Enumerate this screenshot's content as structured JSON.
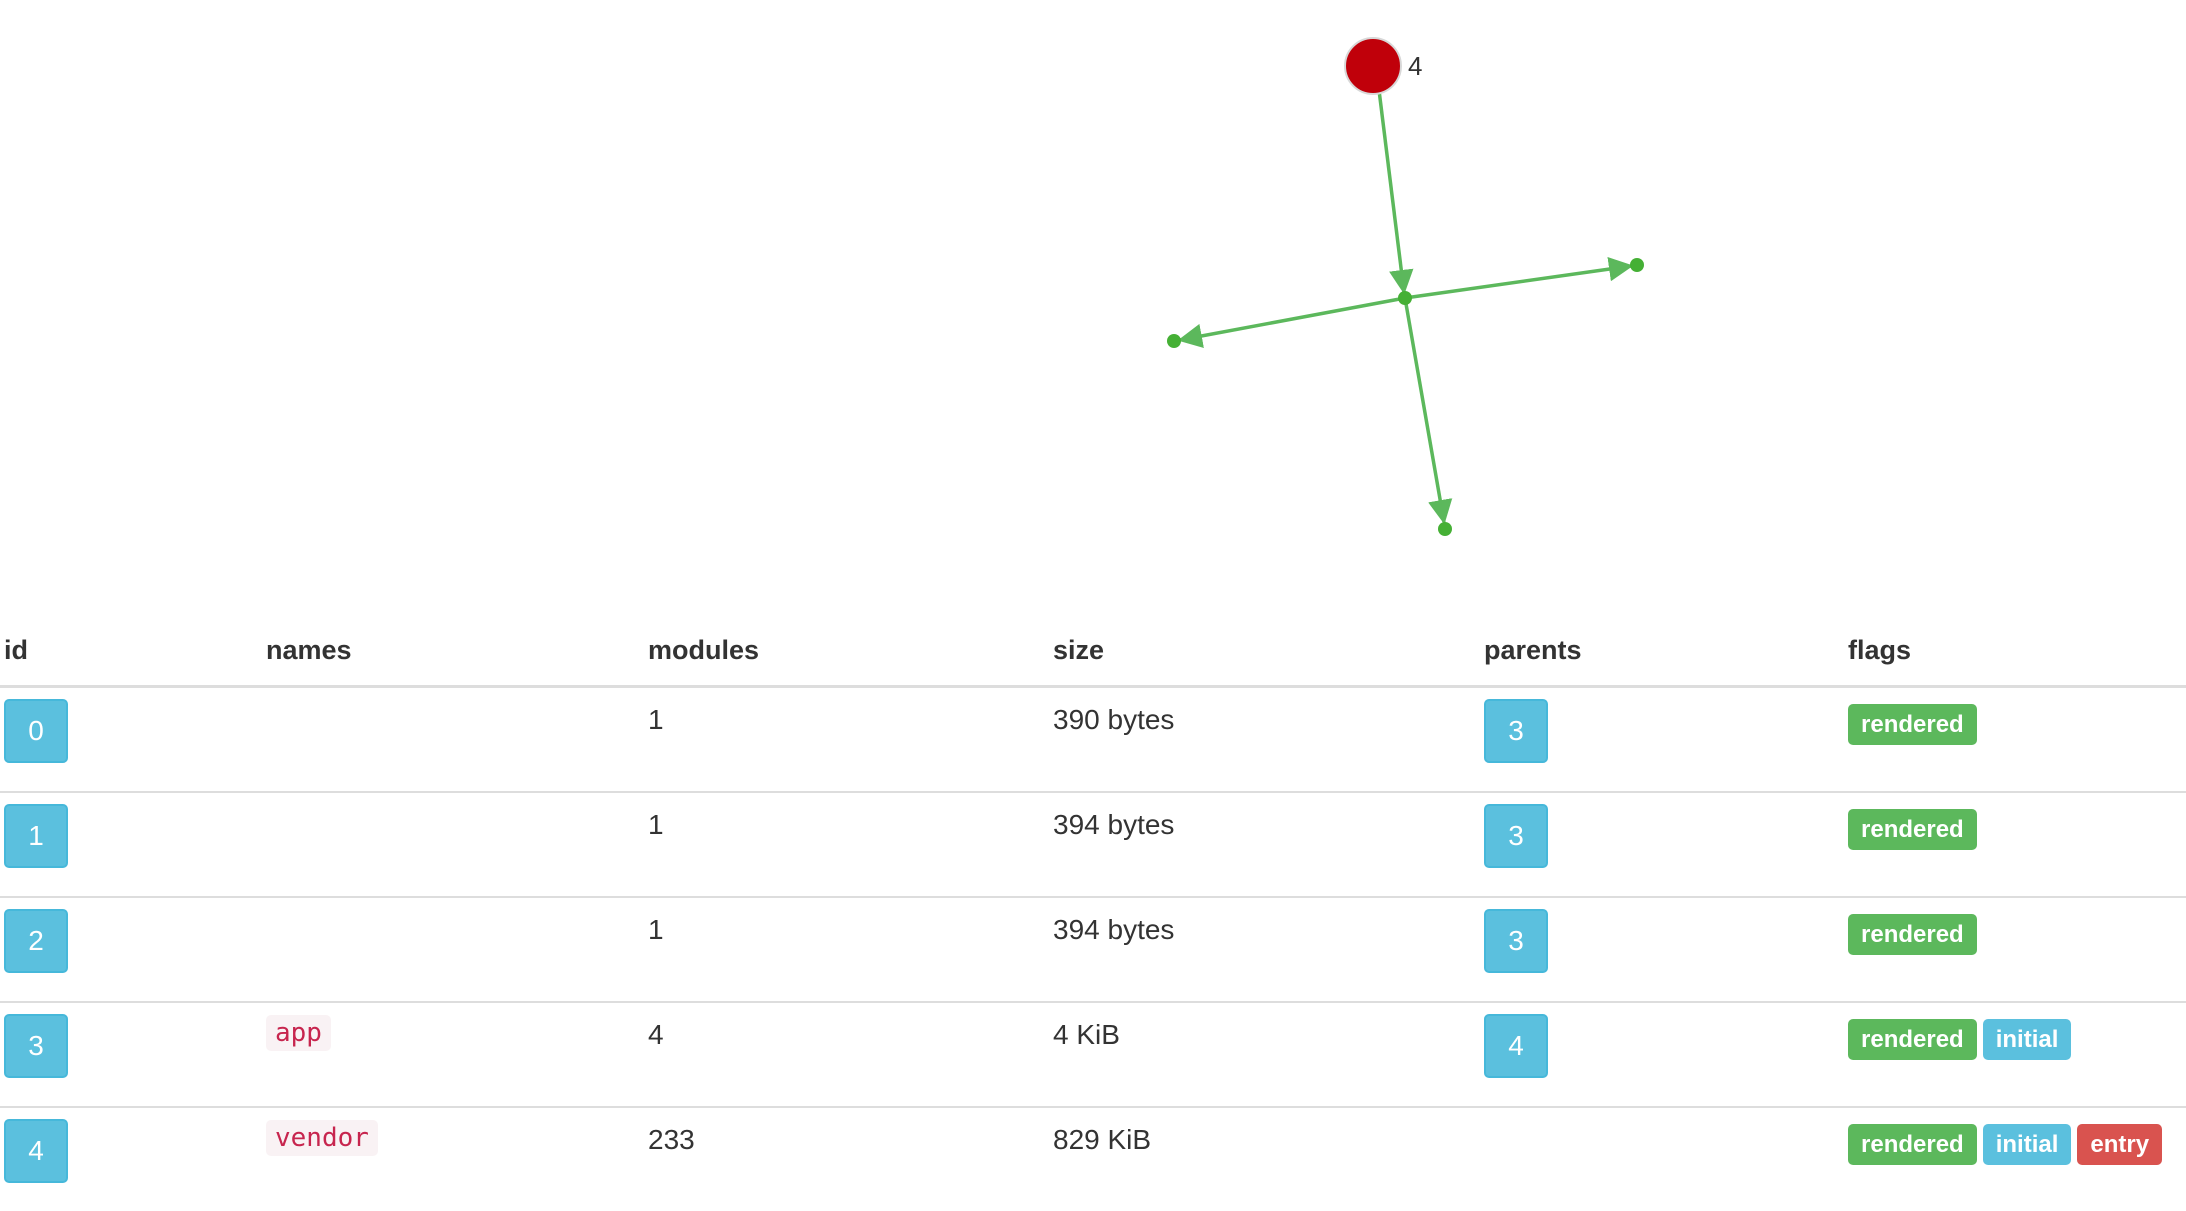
{
  "colors": {
    "edge": "#5cb85c",
    "node_main": "#c0000a",
    "node_small": "#45b035",
    "btn_info": "#5bc0de",
    "label_success": "#5cb85c",
    "label_info": "#5bc0de",
    "label_danger": "#d9534f"
  },
  "graph": {
    "root_label": "4"
  },
  "table": {
    "headers": {
      "id": "id",
      "names": "names",
      "modules": "modules",
      "size": "size",
      "parents": "parents",
      "flags": "flags"
    },
    "rows": [
      {
        "id": "0",
        "name": "",
        "modules": "1",
        "size": "390 bytes",
        "parent": "3",
        "flags": [
          "rendered"
        ]
      },
      {
        "id": "1",
        "name": "",
        "modules": "1",
        "size": "394 bytes",
        "parent": "3",
        "flags": [
          "rendered"
        ]
      },
      {
        "id": "2",
        "name": "",
        "modules": "1",
        "size": "394 bytes",
        "parent": "3",
        "flags": [
          "rendered"
        ]
      },
      {
        "id": "3",
        "name": "app",
        "modules": "4",
        "size": "4 KiB",
        "parent": "4",
        "flags": [
          "rendered",
          "initial"
        ]
      },
      {
        "id": "4",
        "name": "vendor",
        "modules": "233",
        "size": "829 KiB",
        "parent": "",
        "flags": [
          "rendered",
          "initial",
          "entry"
        ]
      }
    ]
  }
}
